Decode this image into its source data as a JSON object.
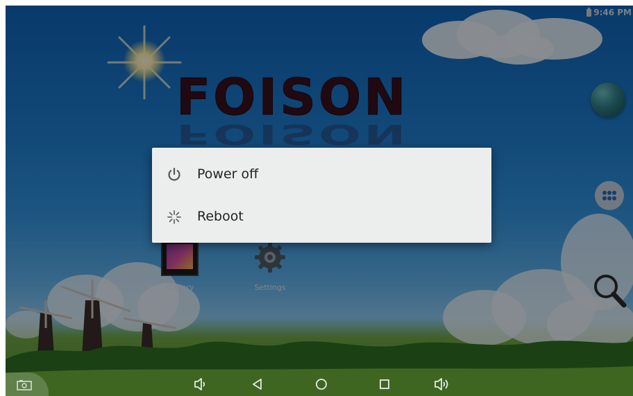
{
  "status_bar": {
    "time": "9:46 PM"
  },
  "brand": {
    "logo_text": "FOISON"
  },
  "home": {
    "apps": [
      {
        "label": "Gallery"
      },
      {
        "label": "Settings"
      }
    ]
  },
  "dialog": {
    "items": [
      {
        "label": "Power off",
        "icon": "power-icon"
      },
      {
        "label": "Reboot",
        "icon": "reboot-icon"
      }
    ]
  },
  "nav_bar": {
    "buttons": [
      "screenshot",
      "volume-down",
      "back",
      "home",
      "recents",
      "volume-up"
    ]
  },
  "colors": {
    "dialog_bg": "#eceeed",
    "dim": "rgba(0,0,0,0.42)"
  }
}
